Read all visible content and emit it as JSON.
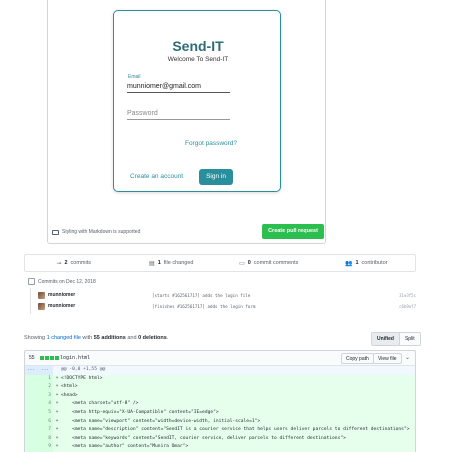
{
  "login_preview": {
    "brand": "Send-IT",
    "welcome": "Welcome To Send-IT",
    "email_label": "Email",
    "email_value": "munniomer@gmail.com",
    "password_placeholder": "Password",
    "forgot_link": "Forgot password?",
    "create_account_link": "Create an account",
    "signin_button": "Sign in"
  },
  "pr_form": {
    "markdown_hint": "Styling with Markdown is supported",
    "create_button": "Create pull request"
  },
  "stats": {
    "commits_count": "2",
    "commits_label": "commits",
    "files_count": "1",
    "files_label": "file changed",
    "comments_count": "0",
    "comments_label": "commit comments",
    "contributors_count": "1",
    "contributors_label": "contributor"
  },
  "commits": {
    "date_header": "Commits on Dec 12, 2018",
    "items": [
      {
        "author": "munniomer",
        "message": "[starts #162561717] adds the login file",
        "sha": "31e3f5c"
      },
      {
        "author": "munniomer",
        "message": "[finishes #162561717] adds the login form",
        "sha": "c6b9ef7"
      }
    ]
  },
  "summary": {
    "prefix": "Showing",
    "changed_link": "1 changed file",
    "with_text": "with",
    "additions": "55 additions",
    "and_text": "and",
    "deletions": "0 deletions",
    "unified": "Unified",
    "split": "Split"
  },
  "file": {
    "count": "55",
    "name": "login.html",
    "copy_path": "Copy path",
    "view_file": "View file",
    "hunk_n": "...",
    "hunk": "@@ -0,0 +1,55 @@",
    "lines": [
      {
        "n": "1",
        "code": "<!DOCTYPE html>"
      },
      {
        "n": "2",
        "code": "<html>"
      },
      {
        "n": "3",
        "code": "<head>"
      },
      {
        "n": "4",
        "code": "    <meta charset=\"utf-8\" />"
      },
      {
        "n": "5",
        "code": "    <meta http-equiv=\"X-UA-Compatible\" content=\"IE=edge\">"
      },
      {
        "n": "6",
        "code": "    <meta name=\"viewport\" content=\"width=device-width, initial-scale=1\">"
      },
      {
        "n": "7",
        "code": "    <meta name=\"description\" content=\"SendIT is a courier service that helps users deliver parcels to different destinations\">"
      },
      {
        "n": "8",
        "code": "    <meta name=\"keywords\" content=\"SendIT, courier service, deliver parcels to different destinations\">"
      },
      {
        "n": "9",
        "code": "    <meta name=\"author\" content=\"Munira Omar\">"
      }
    ]
  },
  "colors": {
    "brand_teal": "#2a8f9c",
    "github_green": "#2cbe4e",
    "addition_bg": "#e6ffed",
    "link_blue": "#0366d6"
  }
}
